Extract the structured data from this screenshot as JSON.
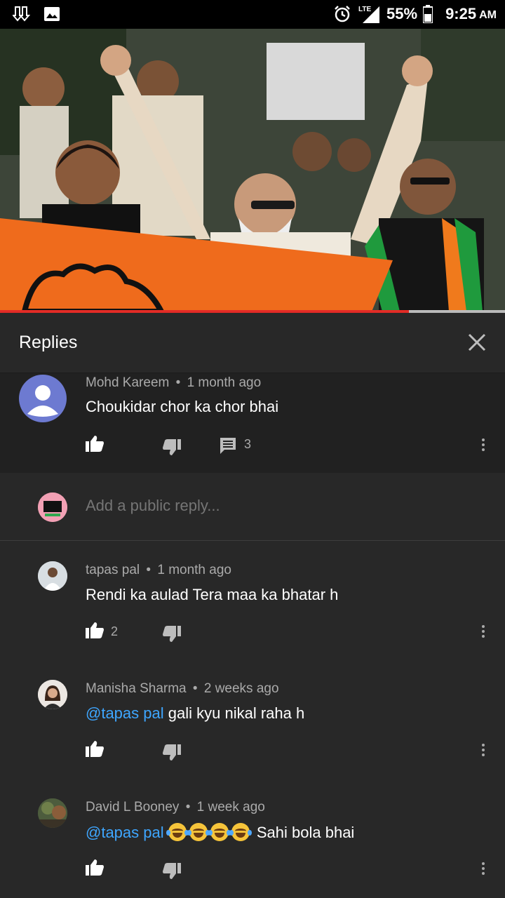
{
  "status_bar": {
    "battery": "55%",
    "time": "9:25",
    "ampm": "AM",
    "network": "LTE"
  },
  "video": {
    "progress_fraction": 0.81
  },
  "replies_panel": {
    "title": "Replies"
  },
  "parent_comment": {
    "author": "Mohd Kareem",
    "time": "1 month ago",
    "text": "Choukidar chor ka chor bhai",
    "reply_count": "3"
  },
  "add_reply": {
    "placeholder": "Add a public reply..."
  },
  "replies": [
    {
      "author": "tapas pal",
      "time": "1 month ago",
      "mention": "",
      "text": "Rendi ka aulad Tera maa ka bhatar h",
      "likes": "2"
    },
    {
      "author": "Manisha Sharma",
      "time": "2 weeks ago",
      "mention": "@tapas pal",
      "text": "gali kyu nikal raha h",
      "likes": ""
    },
    {
      "author": "David L Booney",
      "time": "1 week ago",
      "mention": "@tapas pal",
      "emoji_count": 4,
      "text": "Sahi bola bhai",
      "likes": ""
    }
  ],
  "separator": "•",
  "colors": {
    "background": "#282828",
    "parent_background": "#212121",
    "mention": "#3ea6ff",
    "progress": "#e52d27",
    "meta_text": "#aaaaaa"
  }
}
